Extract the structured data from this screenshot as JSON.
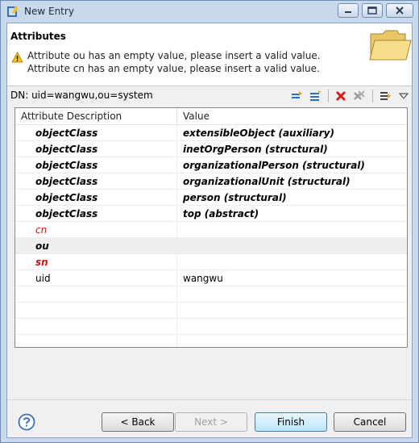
{
  "window": {
    "title": "New Entry"
  },
  "header": {
    "title": "Attributes",
    "warning": "Attribute ou has an empty value, please insert a valid value. Attribute cn has an empty value, please insert a valid value. Attribute sn has an"
  },
  "dn": {
    "label": "DN: uid=wangwu,ou=system"
  },
  "table": {
    "columns": [
      "Attribute Description",
      "Value"
    ],
    "rows": [
      {
        "attr": "objectClass",
        "value": "extensibleObject (auxiliary)"
      },
      {
        "attr": "objectClass",
        "value": "inetOrgPerson (structural)"
      },
      {
        "attr": "objectClass",
        "value": "organizationalPerson (structural)"
      },
      {
        "attr": "objectClass",
        "value": "organizationalUnit (structural)"
      },
      {
        "attr": "objectClass",
        "value": "person (structural)"
      },
      {
        "attr": "objectClass",
        "value": "top (abstract)"
      },
      {
        "attr": "cn",
        "value": ""
      },
      {
        "attr": "ou",
        "value": ""
      },
      {
        "attr": "sn",
        "value": ""
      },
      {
        "attr": "uid",
        "value": "wangwu"
      }
    ]
  },
  "toolbar": {
    "icons": [
      "new-value-icon",
      "new-attribute-icon",
      "delete-icon",
      "delete-all-icon",
      "expand-icon",
      "menu-dropdown-icon"
    ]
  },
  "buttons": {
    "back": "< Back",
    "next": "Next >",
    "finish": "Finish",
    "cancel": "Cancel"
  },
  "colors": {
    "required_attr": "#d01010",
    "accent": "#3c7fb1"
  }
}
